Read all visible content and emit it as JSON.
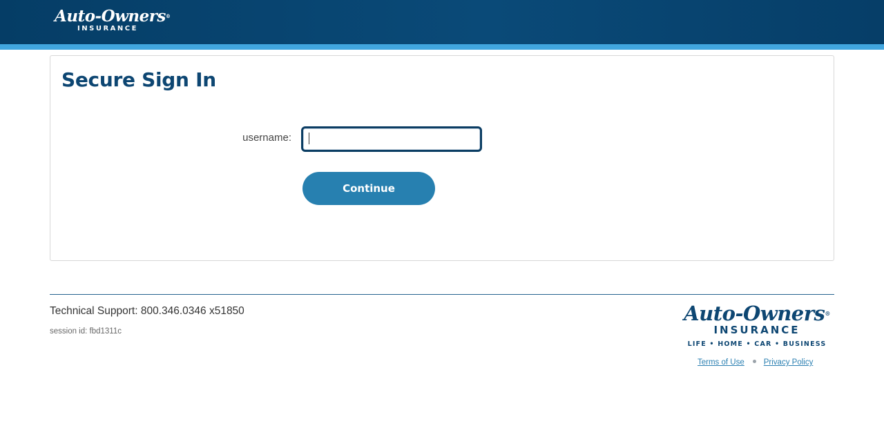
{
  "header": {
    "brand_main": "Auto-Owners",
    "brand_reg": "®",
    "brand_sub": "INSURANCE"
  },
  "card": {
    "title": "Secure Sign In",
    "username_label": "username:",
    "username_value": "",
    "username_placeholder": "",
    "continue_label": "Continue"
  },
  "footer": {
    "support": "Technical Support: 800.346.0346 x51850",
    "session": "session id: fbd1311c",
    "logo_main": "Auto-Owners",
    "logo_reg": "®",
    "logo_sub": "INSURANCE",
    "logo_tagline": "LIFE • HOME • CAR • BUSINESS",
    "terms_label": "Terms of Use",
    "privacy_label": "Privacy Policy"
  },
  "colors": {
    "header_bg": "#0a4a78",
    "header_stripe": "#41a6df",
    "title": "#0d4672",
    "button": "#2780b0",
    "link": "#2a7fb1"
  }
}
